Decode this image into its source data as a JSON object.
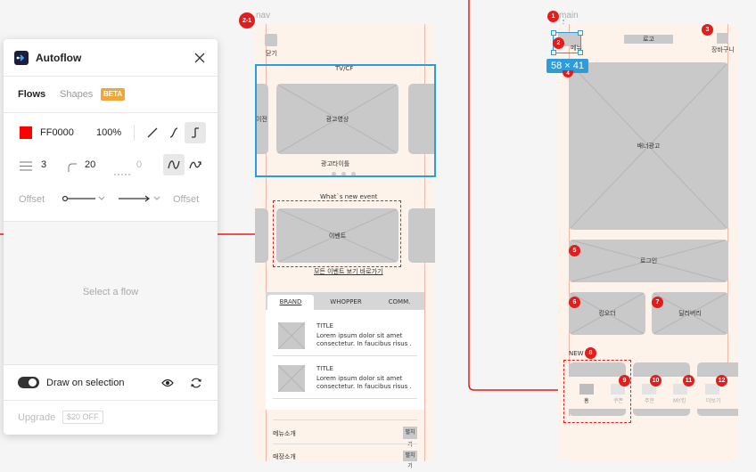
{
  "canvas": {
    "frame_nav_label": "nav",
    "frame_nav_badge": "2-1",
    "frame_main_label": "main",
    "close_label": "닫기",
    "tvcf_label": "TV/CF",
    "prev_label": "이전",
    "ad_video": "광고영상",
    "ad_title": "광고타이틀",
    "whats_new": "What`s new event",
    "event_label": "이벤트",
    "event_more": "모든 이벤트 보기 바로가기",
    "tabs": [
      "BRAND",
      "WHOPPER",
      "COMM."
    ],
    "list_items": [
      {
        "title": "TITLE",
        "body1": "Lorem ipsum dolor sit amet",
        "body2": "consectetur. In faucibus risus ."
      },
      {
        "title": "TITLE",
        "body1": "Lorem ipsum dolor sit amet",
        "body2": "consectetur. In faucibus risus ."
      }
    ],
    "menu_rows": [
      {
        "label": "메뉴소개",
        "button": "펼치기"
      },
      {
        "label": "매장소개",
        "button": "펼치기"
      }
    ],
    "logo_label": "로고",
    "cart_label": "장바구니",
    "menu_icon_label": "메뉴",
    "banner_label": "배너광고",
    "login_label": "로그인",
    "king_order": "킹오더",
    "delivery": "딜리버리",
    "new_label": "NEW",
    "size_tag": "58 × 41",
    "badges": [
      "1",
      "2",
      "3",
      "4",
      "5",
      "6",
      "7",
      "8",
      "9",
      "10",
      "11",
      "12"
    ],
    "bottom_nav": [
      "홈",
      "쿠폰",
      "주문",
      "MY킹",
      "더보기"
    ]
  },
  "panel": {
    "title": "Autoflow",
    "tab_flows": "Flows",
    "tab_shapes": "Shapes",
    "beta": "BETA",
    "color_hex": "FF0000",
    "color_value": "#ff0000",
    "opacity": "100%",
    "stroke_width": "3",
    "corner_radius": "20",
    "dash": "0",
    "offset_left": "Offset",
    "offset_right": "Offset",
    "empty_state": "Select a flow",
    "draw_on_selection": "Draw on selection",
    "upgrade": "Upgrade",
    "price": "$20 OFF"
  },
  "colors": {
    "accent_blue": "#2d9cdb",
    "flow_red": "#e51c1c",
    "beta_orange": "#f0a73a"
  }
}
